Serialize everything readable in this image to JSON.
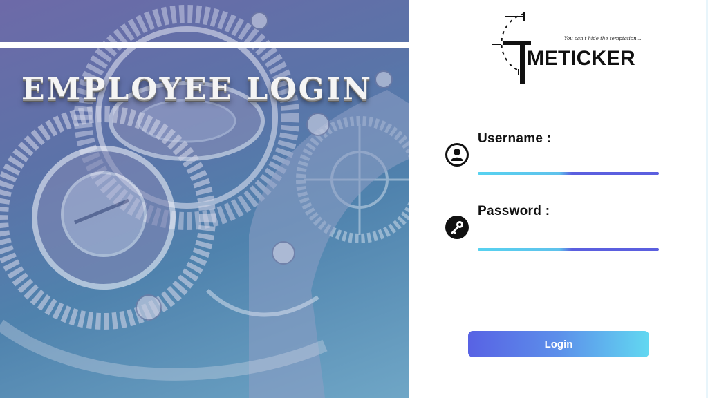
{
  "hero": {
    "title": "EMPLOYEE LOGIN",
    "background_icon": "watch-gears-image"
  },
  "logo": {
    "wordmark": "METICKER",
    "tagline": "You can't hide the temptation..."
  },
  "form": {
    "username": {
      "label": "Username :",
      "value": "",
      "placeholder": "",
      "icon": "user-icon"
    },
    "password": {
      "label": "Password :",
      "value": "",
      "placeholder": "",
      "icon": "key-icon"
    },
    "login_label": "Login"
  },
  "colors": {
    "accent_start": "#5862e4",
    "accent_end": "#62d8f1",
    "hero_tint": "#5b73a8"
  }
}
